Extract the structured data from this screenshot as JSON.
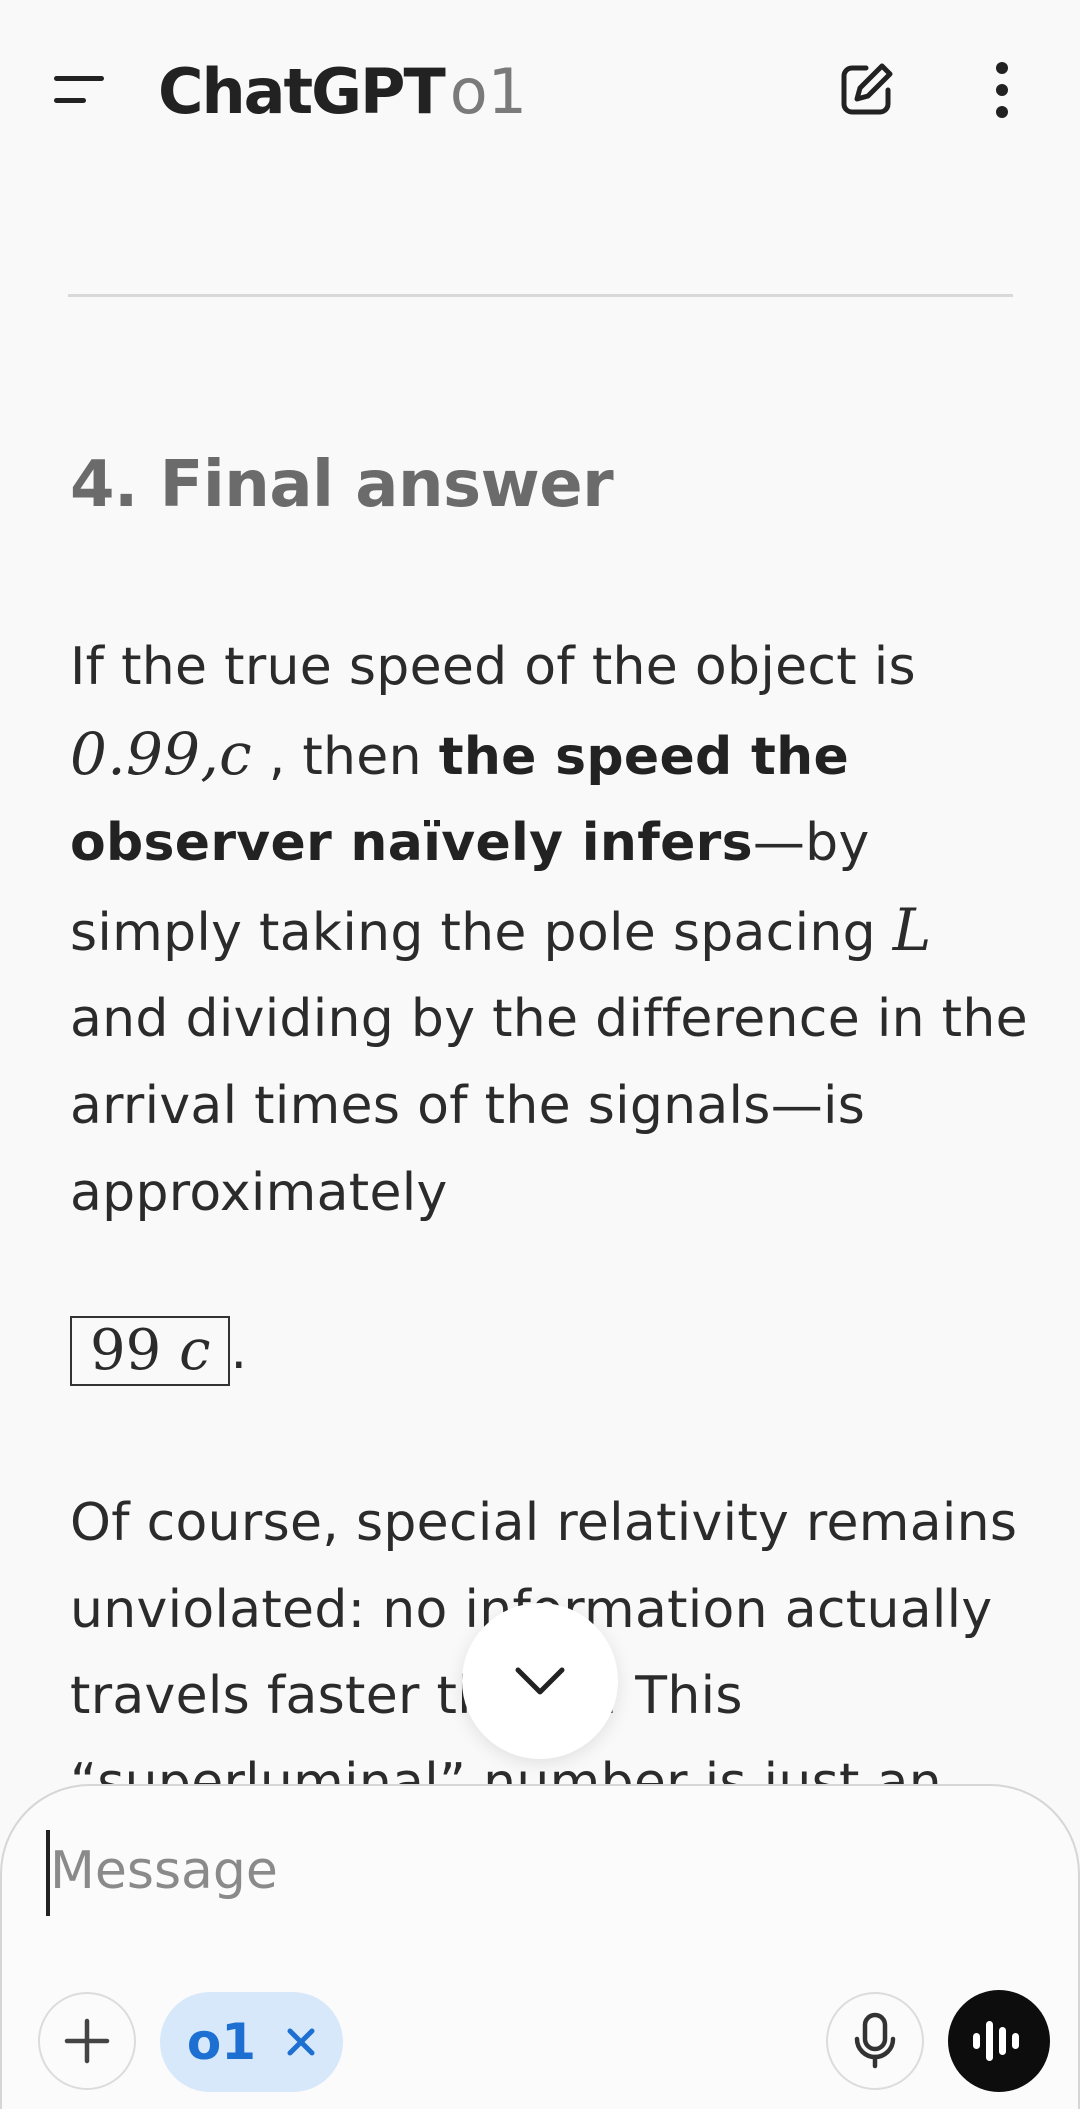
{
  "header": {
    "title": "ChatGPT",
    "model": "o1",
    "icons": {
      "menu": "menu-icon",
      "new_chat": "compose-icon",
      "more": "more-vertical-icon"
    }
  },
  "content": {
    "heading": "4. Final answer",
    "para1": {
      "t1": "If the true speed of the object is ",
      "math_speed": "0.99,",
      "math_c": "c",
      "t2": " , then ",
      "bold": "the speed the observer naïvely infers",
      "t3": "—by simply taking the pole spacing ",
      "math_L": "L",
      "t4": " and dividing by the difference in the arrival times of the signals—is approximately"
    },
    "boxed": {
      "value": "99",
      "unit": "c",
      "suffix": "."
    },
    "para2": "Of course, special relativity remains unviolated: no information actually travels faster than c. This “superluminal” number is just an"
  },
  "composer": {
    "placeholder": "Message",
    "model_chip": "o1"
  },
  "colors": {
    "background": "#f9f9f9",
    "chip_bg": "#d7e8fb",
    "chip_text": "#1d6fd1",
    "voice_button": "#0d0d0d"
  }
}
